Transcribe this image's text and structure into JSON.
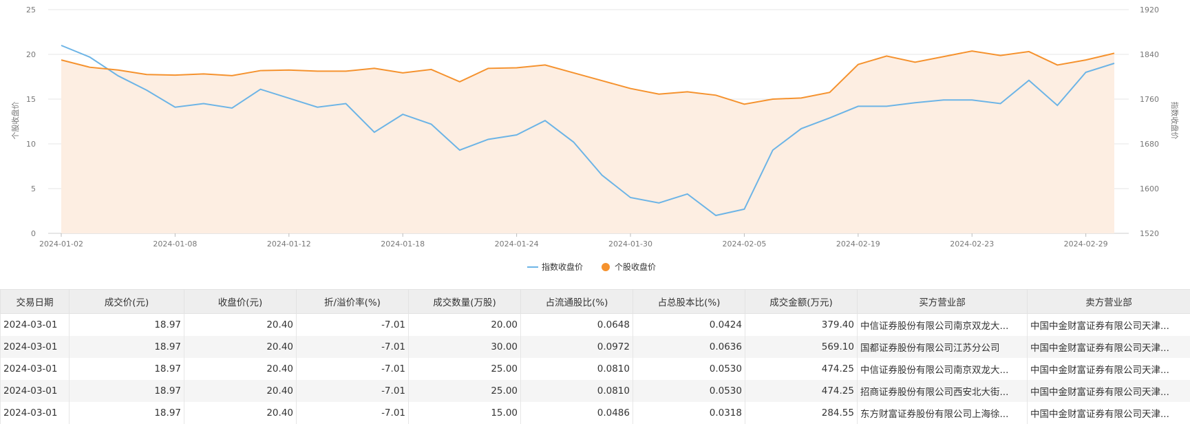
{
  "chart_data": {
    "type": "line",
    "x": [
      "2024-01-02",
      "2024-01-03",
      "2024-01-04",
      "2024-01-05",
      "2024-01-08",
      "2024-01-09",
      "2024-01-10",
      "2024-01-11",
      "2024-01-12",
      "2024-01-15",
      "2024-01-16",
      "2024-01-17",
      "2024-01-18",
      "2024-01-19",
      "2024-01-22",
      "2024-01-23",
      "2024-01-24",
      "2024-01-25",
      "2024-01-26",
      "2024-01-29",
      "2024-01-30",
      "2024-01-31",
      "2024-02-01",
      "2024-02-02",
      "2024-02-05",
      "2024-02-06",
      "2024-02-07",
      "2024-02-08",
      "2024-02-19",
      "2024-02-20",
      "2024-02-21",
      "2024-02-22",
      "2024-02-23",
      "2024-02-26",
      "2024-02-27",
      "2024-02-28",
      "2024-02-29",
      "2024-03-01"
    ],
    "x_tick_labels": [
      "2024-01-02",
      "2024-01-08",
      "2024-01-12",
      "2024-01-18",
      "2024-01-24",
      "2024-01-30",
      "2024-02-05",
      "2024-02-19",
      "2024-02-23",
      "2024-02-29"
    ],
    "series": [
      {
        "name": "指数收盘价",
        "axis": "left",
        "color": "#6cb4e6",
        "values": [
          21.0,
          19.7,
          17.6,
          16.0,
          14.1,
          14.5,
          14.0,
          16.1,
          15.1,
          14.1,
          14.5,
          11.3,
          13.3,
          12.2,
          9.3,
          10.5,
          11.0,
          12.6,
          10.2,
          6.5,
          4.0,
          3.4,
          4.4,
          2.0,
          2.7,
          9.3,
          11.7,
          12.9,
          14.2,
          14.2,
          14.6,
          14.9,
          14.9,
          14.5,
          17.1,
          14.3,
          18.0,
          19.0
        ]
      },
      {
        "name": "个股收盘价",
        "axis": "right",
        "color": "#f5922e",
        "fill": "#fdeee2",
        "values": [
          1830,
          1817,
          1812,
          1804,
          1803,
          1805,
          1802,
          1811,
          1812,
          1810,
          1810,
          1815,
          1807,
          1813,
          1791,
          1815,
          1816,
          1821,
          1807,
          1793,
          1779,
          1769,
          1773,
          1767,
          1751,
          1760,
          1762,
          1772,
          1822,
          1837,
          1826,
          1836,
          1846,
          1838,
          1845,
          1821,
          1830,
          1842
        ]
      }
    ],
    "y_left": {
      "label": "个股收盘价",
      "ticks": [
        "0",
        "5",
        "10",
        "15",
        "20",
        "25"
      ],
      "ylim": [
        0,
        25
      ]
    },
    "y_right": {
      "label": "指数收盘价",
      "ticks": [
        "1520",
        "1600",
        "1680",
        "1760",
        "1840",
        "1920"
      ],
      "ylim": [
        1520,
        1920
      ]
    },
    "legend": [
      {
        "name": "指数收盘价",
        "symbol": "line",
        "color": "#6cb4e6"
      },
      {
        "name": "个股收盘价",
        "symbol": "circle",
        "color": "#f5922e"
      }
    ],
    "legend_position": "bottom-center",
    "grid": true
  },
  "table": {
    "headers": [
      "交易日期",
      "成交价(元)",
      "收盘价(元)",
      "折/溢价率(%)",
      "成交数量(万股)",
      "占流通股比(%)",
      "占总股本比(%)",
      "成交金额(万元)",
      "买方营业部",
      "卖方营业部"
    ],
    "rows": [
      [
        "2024-03-01",
        "18.97",
        "20.40",
        "-7.01",
        "20.00",
        "0.0648",
        "0.0424",
        "379.40",
        "中信证券股份有限公司南京双龙大...",
        "中国中金财富证券有限公司天津..."
      ],
      [
        "2024-03-01",
        "18.97",
        "20.40",
        "-7.01",
        "30.00",
        "0.0972",
        "0.0636",
        "569.10",
        "国都证券股份有限公司江苏分公司",
        "中国中金财富证券有限公司天津..."
      ],
      [
        "2024-03-01",
        "18.97",
        "20.40",
        "-7.01",
        "25.00",
        "0.0810",
        "0.0530",
        "474.25",
        "中信证券股份有限公司南京双龙大...",
        "中国中金财富证券有限公司天津..."
      ],
      [
        "2024-03-01",
        "18.97",
        "20.40",
        "-7.01",
        "25.00",
        "0.0810",
        "0.0530",
        "474.25",
        "招商证券股份有限公司西安北大街...",
        "中国中金财富证券有限公司天津..."
      ],
      [
        "2024-03-01",
        "18.97",
        "20.40",
        "-7.01",
        "15.00",
        "0.0486",
        "0.0318",
        "284.55",
        "东方财富证券股份有限公司上海徐...",
        "中国中金财富证券有限公司天津..."
      ]
    ]
  }
}
